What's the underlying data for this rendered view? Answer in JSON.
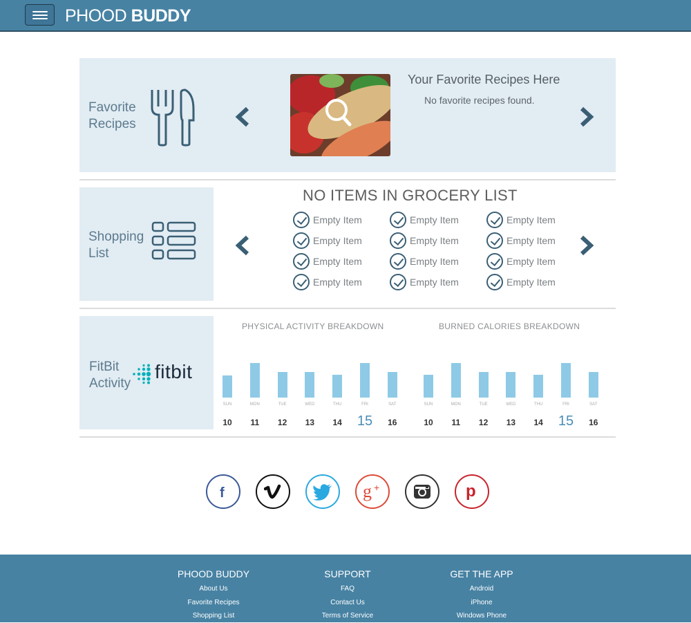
{
  "header": {
    "brand_light": "PHOOD",
    "brand_bold": "BUDDY"
  },
  "favorites": {
    "label_line1": "Favorite",
    "label_line2": "Recipes",
    "title": "Your Favorite Recipes Here",
    "empty_message": "No favorite recipes found."
  },
  "shopping": {
    "label_line1": "Shopping",
    "label_line2": "List",
    "title": "NO ITEMS IN GROCERY LIST",
    "items": [
      "Empty Item",
      "Empty Item",
      "Empty Item",
      "Empty Item",
      "Empty Item",
      "Empty Item",
      "Empty Item",
      "Empty Item",
      "Empty Item",
      "Empty Item",
      "Empty Item",
      "Empty Item"
    ]
  },
  "fitbit": {
    "label_line1": "FitBit",
    "label_line2": "Activity",
    "logo_text": "fitbit",
    "logo_mark": "fitbit-logo-icon"
  },
  "chart_data": [
    {
      "type": "bar",
      "title": "PHYSICAL ACTIVITY BREAKDOWN",
      "categories": [
        "SUN",
        "MON",
        "TUE",
        "WED",
        "THU",
        "FRI",
        "SAT"
      ],
      "dates": [
        "10",
        "11",
        "12",
        "13",
        "14",
        "15",
        "16"
      ],
      "active_date": "15",
      "values": [
        32,
        50,
        37,
        37,
        33,
        50,
        37
      ],
      "ylim": [
        0,
        50
      ],
      "grid": false,
      "xlabel": "",
      "ylabel": ""
    },
    {
      "type": "bar",
      "title": "BURNED CALORIES BREAKDOWN",
      "categories": [
        "SUN",
        "MON",
        "TUE",
        "WED",
        "THU",
        "FRI",
        "SAT"
      ],
      "dates": [
        "10",
        "11",
        "12",
        "13",
        "14",
        "15",
        "16"
      ],
      "active_date": "15",
      "values": [
        33,
        50,
        37,
        37,
        33,
        50,
        37
      ],
      "ylim": [
        0,
        50
      ],
      "grid": false,
      "xlabel": "",
      "ylabel": ""
    }
  ],
  "social": [
    {
      "name": "facebook-icon",
      "glyph": "f",
      "color": "#3b5998"
    },
    {
      "name": "vimeo-icon",
      "glyph": "v",
      "color": "#111111"
    },
    {
      "name": "twitter-icon",
      "glyph": "",
      "color": "#2aa9e0"
    },
    {
      "name": "google-plus-icon",
      "glyph": "g+",
      "color": "#dd4b39"
    },
    {
      "name": "instagram-icon",
      "glyph": "",
      "color": "#333333"
    },
    {
      "name": "pinterest-icon",
      "glyph": "p",
      "color": "#c8232c"
    }
  ],
  "footer": {
    "col1": {
      "title": "PHOOD BUDDY",
      "links": [
        "About Us",
        "Favorite Recipes",
        "Shopping List"
      ]
    },
    "col2": {
      "title": "SUPPORT",
      "links": [
        "FAQ",
        "Contact Us",
        "Terms of Service"
      ]
    },
    "col3": {
      "title": "GET THE APP",
      "links": [
        "Android",
        "iPhone",
        "Windows Phone"
      ]
    }
  },
  "colors": {
    "brand": "#4782a3",
    "tile": "#e2ecf3",
    "bar": "#8ecae6",
    "accent_date": "#4a8db5",
    "icon_dark": "#3a5f75"
  }
}
